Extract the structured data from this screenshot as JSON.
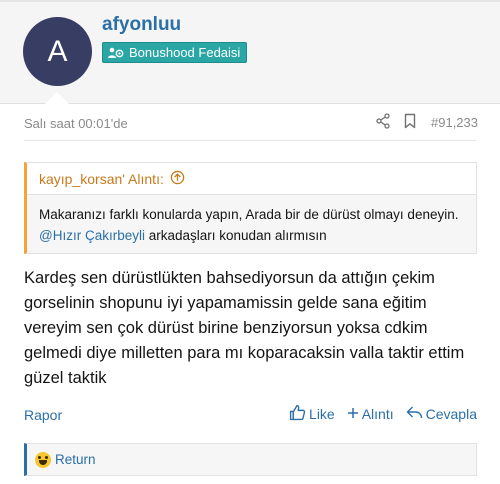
{
  "user": {
    "avatar_letter": "A",
    "name": "afyonluu",
    "badge": "Bonushood Fedaisi",
    "colors": {
      "avatar_bg": "#373d63",
      "badge_bg": "#2aa7a5",
      "username": "#2b6fa8"
    }
  },
  "post": {
    "date": "Salı saat 00:01'de",
    "number": "#91,233",
    "icons": [
      "share-icon",
      "bookmark-icon"
    ],
    "quote": {
      "author": "kayıp_korsan' Alıntı:",
      "text_before": "Makaranızı farklı konularda yapın, Arada bir de dürüst olmayı deneyin.",
      "mention": "@Hızır Çakırbeyli",
      "text_after": "arkadaşları konudan alırmısın"
    },
    "body": "Kardeş sen dürüstlükten bahsediyorsun da attığın çekim gorselinin shopunu iyi yapamamissin gelde sana eğitim vereyim sen çok dürüst birine benziyorsun yoksa cdkim gelmedi diye milletten para mı koparacaksin valla taktir ettim güzel taktik"
  },
  "actions": {
    "report": "Rapor",
    "like": "Like",
    "quote": "Alıntı",
    "reply": "Cevapla"
  },
  "reactions": {
    "label": "Return",
    "emoji": "laughing-emoji"
  }
}
